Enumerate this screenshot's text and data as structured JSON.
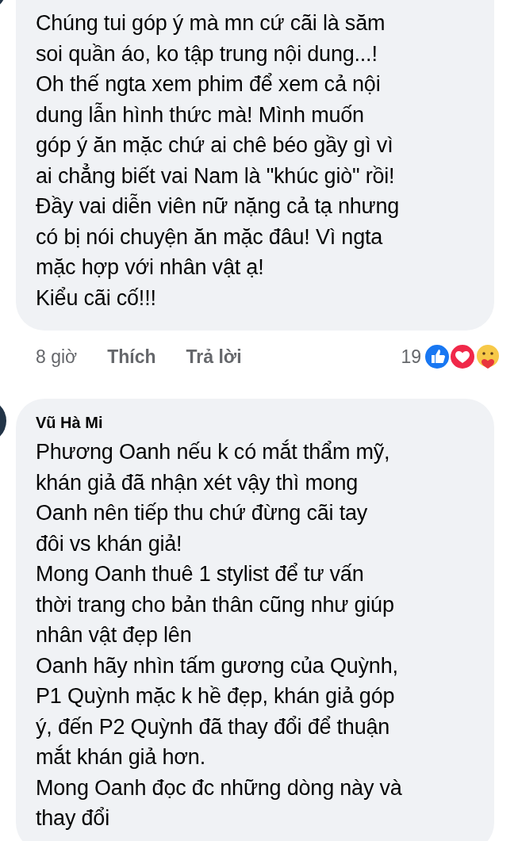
{
  "comments": [
    {
      "lines": [
        "Chúng tui góp ý mà mn cứ cãi là săm",
        "soi quần áo, ko tập trung nội dung...!",
        "Oh thế ngta xem phim để xem cả nội",
        "dung lẫn hình thức mà! Mình muốn",
        "góp ý ăn mặc chứ ai chê béo gầy gì vì",
        "ai chẳng biết vai Nam là \"khúc giò\" rồi!",
        "Đầy vai diễn viên nữ nặng cả tạ nhưng",
        "có bị nói chuyện ăn mặc đâu! Vì ngta",
        "mặc hợp với nhân vật ạ!",
        "Kiểu cãi cố!!!"
      ],
      "time": "8 giờ",
      "actions": [
        "Thích",
        "Trả lời"
      ],
      "reaction_count": "19",
      "reactions": [
        {
          "kind": "like"
        },
        {
          "kind": "love"
        },
        {
          "kind": "care"
        }
      ]
    },
    {
      "author": "Vũ Hà Mi",
      "lines": [
        "Phương Oanh nếu k có mắt thẩm mỹ,",
        "khán giả đã nhận xét vậy thì mong",
        "Oanh nên tiếp thu chứ đừng cãi tay",
        "đôi vs khán giả!",
        "Mong Oanh thuê 1 stylist để tư vấn",
        "thời trang cho bản thân cũng như giúp",
        "nhân vật đẹp lên",
        "Oanh hãy nhìn tấm gương của Quỳnh,",
        "P1 Quỳnh mặc k hề đẹp, khán giả góp",
        "ý, đến P2 Quỳnh đã thay đổi để thuận",
        "mắt khán giả hơn.",
        "Mong Oanh đọc đc những dòng này và",
        "thay đổi"
      ]
    }
  ]
}
